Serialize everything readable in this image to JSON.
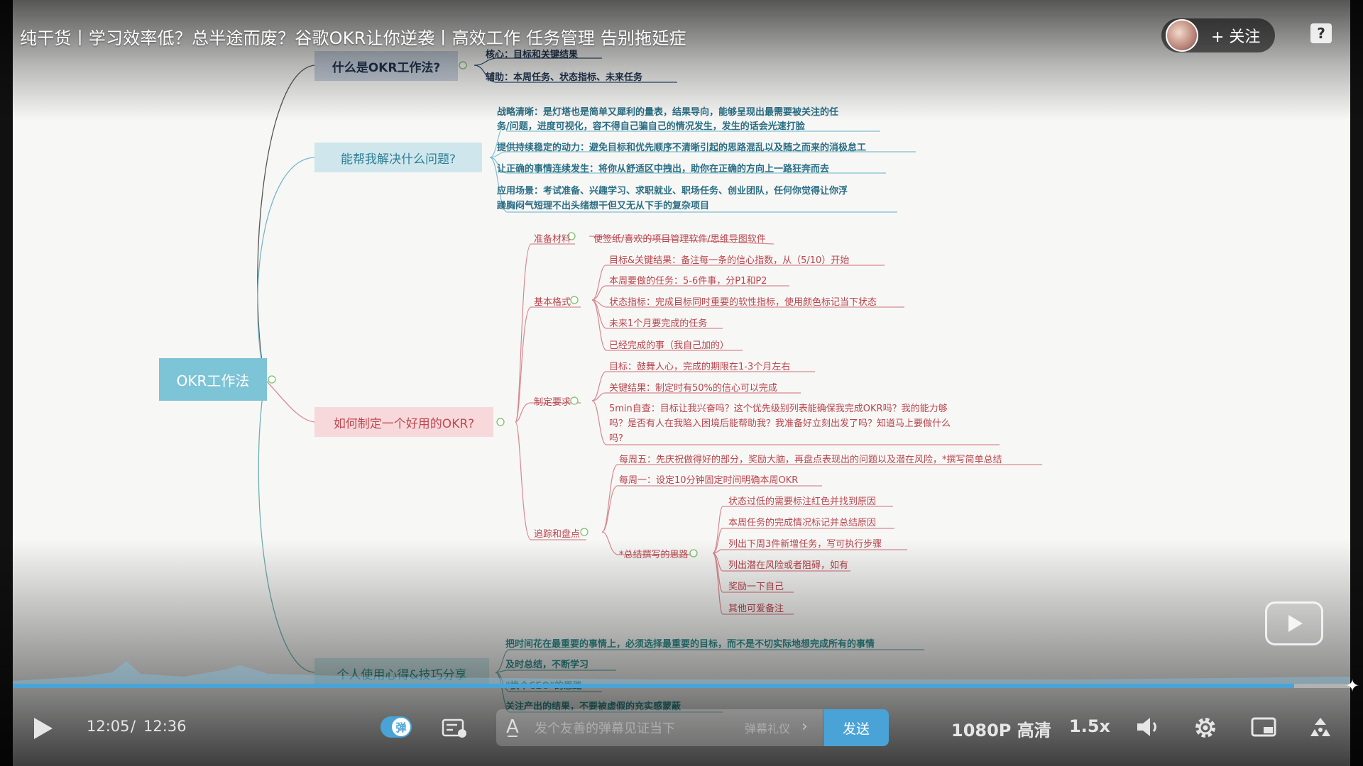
{
  "video": {
    "title": "纯干货丨学习效率低？总半途而废？谷歌OKR让你逆袭丨高效工作 任务管理 告别拖延症",
    "follow_label": "+ 关注",
    "help_glyph": "?"
  },
  "mindmap": {
    "root": "OKR工作法",
    "branch1": {
      "title": "什么是OKR工作法?",
      "leaves": [
        "核心：目标和关键结果",
        "辅助：本周任务、状态指标、未来任务"
      ]
    },
    "branch2": {
      "title": "能帮我解决什么问题?",
      "leaves": [
        "战略清晰：是灯塔也是简单又犀利的量表，结果导向，能够呈现出最需要被关注的任",
        "务/问题，进度可视化，容不得自己骗自己的情况发生，发生的话会光速打脸",
        "提供持续稳定的动力：避免目标和优先顺序不清晰引起的思路混乱以及随之而来的消极怠工",
        "让正确的事情连续发生：将你从舒适区中拽出，助你在正确的方向上一路狂奔而去",
        "应用场景：考试准备、兴趣学习、求职就业、职场任务、创业团队，任何你觉得让你浮",
        "躁胸闷气短理不出头绪想干但又无从下手的复杂项目"
      ]
    },
    "branch3": {
      "title": "如何制定一个好用的OKR?",
      "prep": {
        "label": "准备材料",
        "leaf": "便签纸/喜欢的项目管理软件/思维导图软件"
      },
      "format": {
        "label": "基本格式",
        "leaves": [
          "目标&关键结果：备注每一条的信心指数，从（5/10）开始",
          "本周要做的任务：5-6件事，分P1和P2",
          "状态指标：完成目标同时重要的软性指标，使用颜色标记当下状态",
          "未来1个月要完成的任务",
          "已经完成的事（我自己加的）"
        ]
      },
      "requirements": {
        "label": "制定要求",
        "leaves": [
          "目标：鼓舞人心，完成的期限在1-3个月左右",
          "关键结果：制定时有50%的信心可以完成",
          "5min自查：目标让我兴奋吗？这个优先级别列表能确保我完成OKR吗？我的能力够",
          "吗？是否有人在我陷入困境后能帮助我？我准备好立刻出发了吗？知道马上要做什么",
          "吗?"
        ]
      },
      "tracking": {
        "label": "追踪和盘点",
        "leaves": [
          "每周五：先庆祝做得好的部分，奖励大脑，再盘点表现出的问题以及潜在风险，*撰写简单总结",
          "每周一：设定10分钟固定时间明确本周OKR"
        ],
        "summary": {
          "label": "*总结撰写的思路",
          "leaves": [
            "状态过低的需要标注红色并找到原因",
            "本周任务的完成情况标记并总结原因",
            "列出下周3件新增任务，写可执行步骤",
            "列出潜在风险或者阻碍，如有",
            "奖励一下自己",
            "其他可爱备注"
          ]
        }
      }
    },
    "branch4": {
      "title": "个人使用心得&技巧分享",
      "leaves": [
        "把时间花在最重要的事情上，必须选择最重要的目标，而不是不切实际地想完成所有的事情",
        "及时总结，不断学习",
        "\"换个CEO\"的思路",
        "关注产出的结果，不要被虚假的充实感蒙蔽"
      ]
    }
  },
  "controls": {
    "time_current": "12:05",
    "time_separator": "/",
    "time_total": "12:36",
    "progress_fraction": 0.958,
    "danmaku_toggle_glyph": "弹",
    "danmaku_placeholder": "发个友善的弹幕见证当下",
    "danmaku_etiquette": "弹幕礼仪",
    "send_label": "发送",
    "quality_label": "1080P 高清",
    "speed_label": "1.5x"
  },
  "colors": {
    "root_bg": "#7cc4d6",
    "branch1_bg": "#c9d2de",
    "branch2_bg": "#cfe7ec",
    "branch3_bg": "#f7d9dc",
    "branch4_bg": "#cfe7e7",
    "accent": "#4aa3d6"
  }
}
